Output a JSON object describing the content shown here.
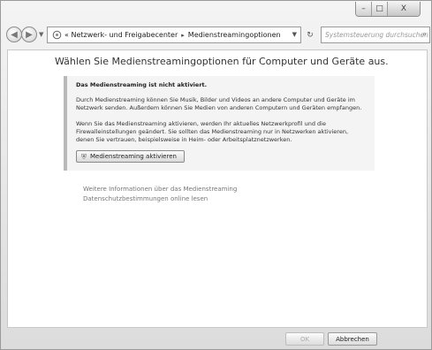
{
  "window": {
    "caption": {
      "minimize": "–",
      "maximize": "□",
      "close": "X"
    }
  },
  "nav": {
    "back_icon": "back-arrow-icon",
    "forward_icon": "forward-arrow-icon",
    "address": {
      "icon": "network-icon",
      "prefix": "«",
      "crumb1": "Netzwerk- und Freigabecenter",
      "separator": "▸",
      "crumb2": "Medienstreamingoptionen"
    },
    "search_placeholder": "Systemsteuerung durchsuchen"
  },
  "main": {
    "title": "Wählen Sie Medienstreamingoptionen für Computer und Geräte aus.",
    "info": {
      "heading": "Das Medienstreaming ist nicht aktiviert.",
      "paragraph1": "Durch Medienstreaming können Sie Musik, Bilder und Videos an andere Computer und Geräte im Netzwerk senden. Außerdem können Sie Medien von anderen Computern und Geräten empfangen.",
      "paragraph2": "Wenn Sie das Medienstreaming aktivieren, werden Ihr aktuelles Netzwerkprofil und die Firewalleinstellungen geändert. Sie sollten das Medienstreaming nur in Netzwerken aktivieren, denen Sie vertrauen, beispielsweise in Heim- oder Arbeitsplatznetzwerken.",
      "activate_button": "Medienstreaming aktivieren"
    },
    "links": {
      "more_info": "Weitere Informationen über das Medienstreaming",
      "privacy": "Datenschutzbestimmungen online lesen"
    }
  },
  "footer": {
    "ok_label": "OK",
    "cancel_label": "Abbrechen"
  }
}
